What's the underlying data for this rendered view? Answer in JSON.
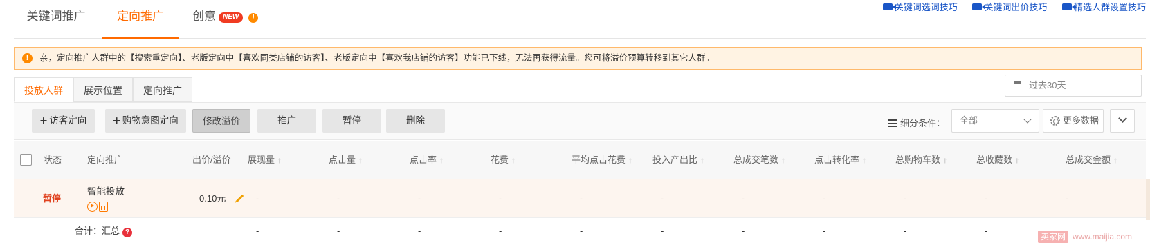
{
  "top_tabs": [
    {
      "label": "关键词推广"
    },
    {
      "label": "定向推广"
    },
    {
      "label": "创意",
      "badge": "NEW"
    }
  ],
  "tips": [
    {
      "label": "关键词选词技巧"
    },
    {
      "label": "关键词出价技巧"
    },
    {
      "label": "精选人群设置技巧"
    }
  ],
  "notice": {
    "text": "亲，定向推广人群中的【搜索重定向】、老版定向中【喜欢同类店铺的访客】、老版定向中【喜欢我店铺的访客】功能已下线，无法再获得流量。您可将溢价预算转移到其它人群。"
  },
  "sub_tabs": [
    {
      "label": "投放人群"
    },
    {
      "label": "展示位置"
    },
    {
      "label": "定向推广"
    }
  ],
  "date_range": {
    "label": "过去30天"
  },
  "toolbar": {
    "visitor_targeting": "访客定向",
    "purchase_intent_targeting": "购物意图定向",
    "edit_premium": "修改溢价",
    "promote": "推广",
    "pause": "暂停",
    "delete": "删除",
    "filter_label": "细分条件：",
    "filter_value": "全部",
    "more_data": "更多数据"
  },
  "table": {
    "columns": [
      "状态",
      "定向推广",
      "出价/溢价",
      "展现量",
      "点击量",
      "点击率",
      "花费",
      "平均点击花费",
      "投入产出比",
      "总成交笔数",
      "点击转化率",
      "总购物车数",
      "总收藏数",
      "总成交金额"
    ],
    "row": {
      "status": "暂停",
      "name": "智能投放",
      "bid": "0.10元",
      "metrics": [
        "-",
        "-",
        "-",
        "-",
        "-",
        "-",
        "-",
        "-",
        "-",
        "-",
        "-"
      ]
    },
    "total": {
      "label": "合计：汇总",
      "metrics": [
        "-",
        "-",
        "-",
        "-",
        "-",
        "-",
        "-",
        "-",
        "-",
        "-",
        "-"
      ]
    }
  },
  "watermark": {
    "box": "卖家网",
    "url": "www.maijia.com"
  },
  "colors": {
    "accent": "#ff6a00",
    "link": "#1a56c7",
    "status_paused": "#e0421f",
    "notice_bg": "#fff3e3"
  }
}
